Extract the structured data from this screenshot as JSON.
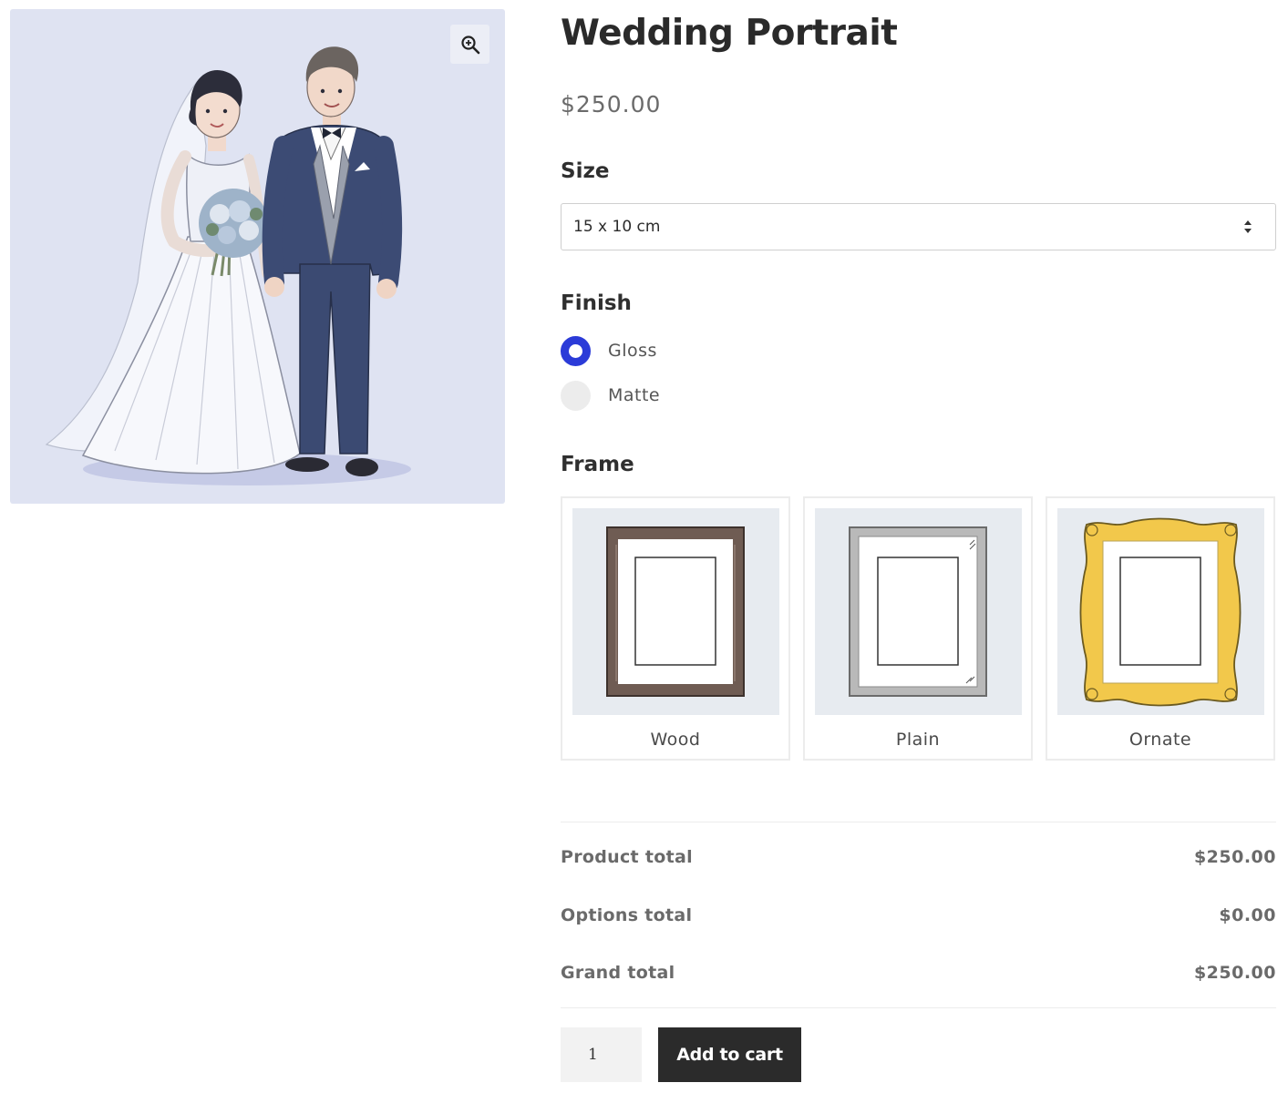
{
  "product": {
    "title": "Wedding Portrait",
    "price": "$250.00",
    "image_alt": "Illustration of a bride and groom",
    "zoom_icon": "zoom-in-icon"
  },
  "size": {
    "label": "Size",
    "selected": "15 x 10 cm"
  },
  "finish": {
    "label": "Finish",
    "options": [
      {
        "label": "Gloss",
        "selected": true
      },
      {
        "label": "Matte",
        "selected": false
      }
    ]
  },
  "frame": {
    "label": "Frame",
    "options": [
      {
        "label": "Wood",
        "color": "#6f5c53"
      },
      {
        "label": "Plain",
        "color": "#b9b9b9"
      },
      {
        "label": "Ornate",
        "color": "#f2c84b"
      }
    ]
  },
  "totals": {
    "product_label": "Product total",
    "product_value": "$250.00",
    "options_label": "Options total",
    "options_value": "$0.00",
    "grand_label": "Grand total",
    "grand_value": "$250.00"
  },
  "cart": {
    "quantity": "1",
    "button_label": "Add to cart"
  },
  "colors": {
    "accent_radio": "#2b3bd8",
    "button_bg": "#2b2b2b",
    "image_bg": "#dfe3f2"
  }
}
